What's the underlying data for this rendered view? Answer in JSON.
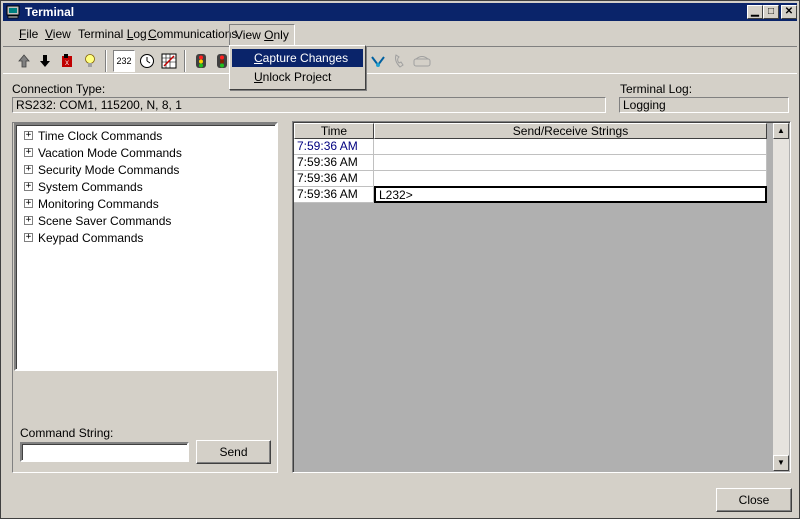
{
  "window": {
    "title": "Terminal"
  },
  "menubar": {
    "file": {
      "hot": "F",
      "rest": "ile"
    },
    "view": {
      "hot": "V",
      "rest": "iew"
    },
    "terminal_log": {
      "pre": "Terminal ",
      "hot": "L",
      "rest": "og"
    },
    "communications": {
      "hot": "C",
      "rest": "ommunications"
    },
    "view_only": {
      "pre": "View ",
      "hot": "O",
      "rest": "nly"
    }
  },
  "dropdown": {
    "items": [
      {
        "hot": "C",
        "rest": "apture Changes",
        "selected": true
      },
      {
        "hot": "U",
        "rest": "nlock Project",
        "selected": false
      }
    ]
  },
  "toolbar": {
    "port_label": "232"
  },
  "connection": {
    "label": "Connection Type:",
    "value": "RS232: COM1, 115200, N, 8, 1"
  },
  "terminal_log": {
    "label": "Terminal Log:",
    "value": "Logging"
  },
  "tree": {
    "items": [
      "Time Clock Commands",
      "Vacation Mode Commands",
      "Security Mode Commands",
      "System Commands",
      "Monitoring Commands",
      "Scene Saver Commands",
      "Keypad Commands"
    ]
  },
  "command": {
    "label": "Command String:",
    "value": "",
    "send": "Send"
  },
  "log": {
    "headers": {
      "time": "Time",
      "strings": "Send/Receive Strings"
    },
    "rows": [
      {
        "time": "7:59:36 AM",
        "text": ""
      },
      {
        "time": "7:59:36 AM",
        "text": ""
      },
      {
        "time": "7:59:36 AM",
        "text": ""
      },
      {
        "time": "7:59:36 AM",
        "text": "L232>"
      }
    ]
  },
  "footer": {
    "close": "Close"
  },
  "colors": {
    "titlebar": "#0a246a",
    "highlight": "#0a246a",
    "time_blue": "#000080",
    "face": "#d4d0c8"
  }
}
